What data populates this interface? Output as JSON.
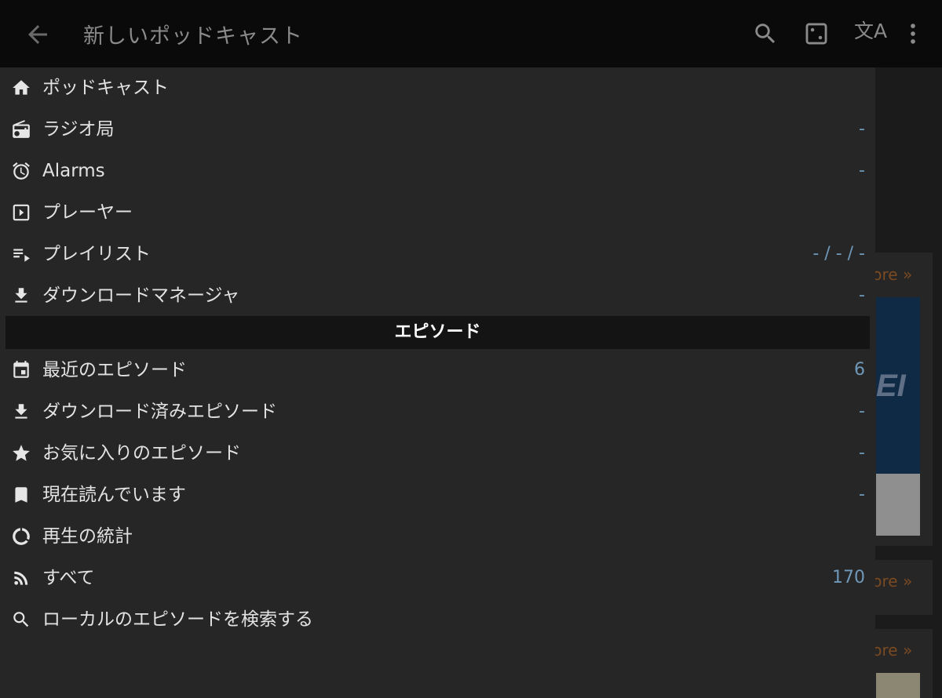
{
  "app_bar": {
    "title": "新しいポッドキャスト",
    "translate_glyph": "文A",
    "icons": [
      "arrow-back-icon",
      "search-icon",
      "dice-icon",
      "translate-icon",
      "more-vert-icon"
    ]
  },
  "drawer": {
    "items": [
      {
        "label": "ポッドキャスト",
        "count": "",
        "icon": "home-icon"
      },
      {
        "label": "ラジオ局",
        "count": "-",
        "icon": "radio-icon"
      },
      {
        "label": "Alarms",
        "count": "-",
        "icon": "alarm-icon"
      },
      {
        "label": "プレーヤー",
        "count": "",
        "icon": "play-box-icon"
      },
      {
        "label": "プレイリスト",
        "count": "- / - / -",
        "icon": "playlist-icon"
      },
      {
        "label": "ダウンロードマネージャ",
        "count": "-",
        "icon": "download-icon"
      }
    ],
    "section_title": "エピソード",
    "episode_items": [
      {
        "label": "最近のエピソード",
        "count": "6",
        "icon": "calendar-icon"
      },
      {
        "label": "ダウンロード済みエピソード",
        "count": "-",
        "icon": "download-icon"
      },
      {
        "label": "お気に入りのエピソード",
        "count": "-",
        "icon": "star-icon"
      },
      {
        "label": "現在読んでいます",
        "count": "-",
        "icon": "bookmark-icon"
      },
      {
        "label": "再生の統計",
        "count": "",
        "icon": "donut-chart-icon"
      },
      {
        "label": "すべて",
        "count": "170",
        "icon": "rss-icon"
      },
      {
        "label": "ローカルのエピソードを検索する",
        "count": "",
        "icon": "search-icon"
      }
    ]
  },
  "background": {
    "more_link": "More »",
    "art_logo": "EI"
  },
  "colors": {
    "app_bar": "#0a0a0a",
    "drawer": "#262626",
    "section_header": "#141414",
    "count_text": "#6f98b8",
    "more_link": "#7a4a22"
  }
}
